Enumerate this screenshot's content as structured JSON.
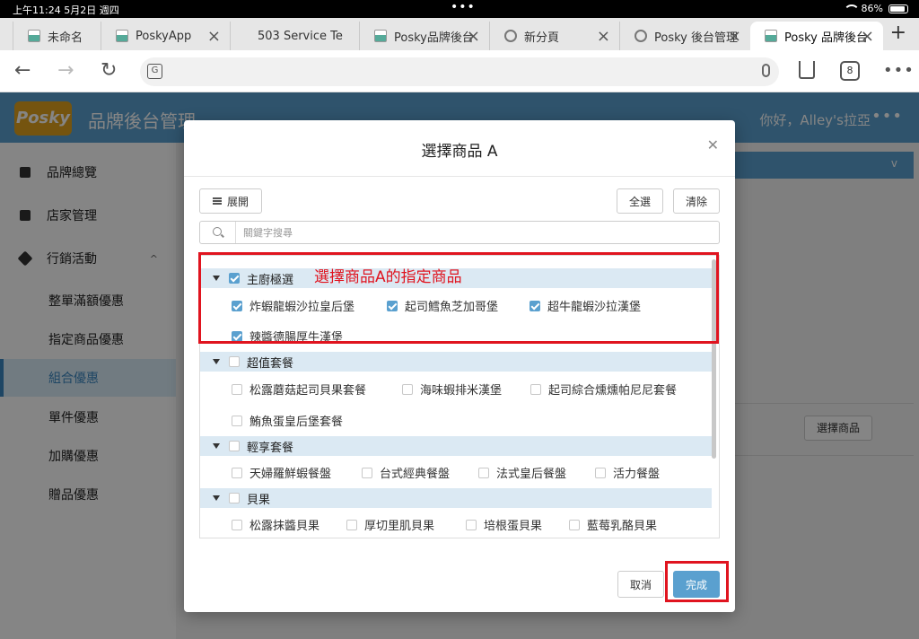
{
  "status": {
    "time": "上午11:24  5月2日 週四",
    "battery": "86%"
  },
  "tabs": [
    {
      "title": "未命名",
      "favicon": "mountain-favicon"
    },
    {
      "title": "PoskyApp",
      "favicon": "mountain-favicon"
    },
    {
      "title": "503 Service Te",
      "favicon": "none"
    },
    {
      "title": "Posky品牌後台",
      "favicon": "mountain-favicon"
    },
    {
      "title": "新分頁",
      "favicon": "globe-favicon"
    },
    {
      "title": "Posky 後台管理",
      "favicon": "globe-favicon"
    },
    {
      "title": "Posky 品牌後台",
      "favicon": "mountain-favicon",
      "active": true
    }
  ],
  "toolbar": {
    "tab_count": "8",
    "translate_glyph": "G"
  },
  "app": {
    "logo": "Posky",
    "title": "品牌後台管理",
    "greeting": "你好，Alley's拉亞",
    "select_goods_label": "選擇商品"
  },
  "sidebar": {
    "items": [
      {
        "label": "品牌總覽",
        "icon": "home-icon"
      },
      {
        "label": "店家管理",
        "icon": "store-icon"
      },
      {
        "label": "行銷活動",
        "icon": "send-icon",
        "expanded": true
      },
      {
        "label": "整單滿額優惠"
      },
      {
        "label": "指定商品優惠"
      },
      {
        "label": "組合優惠",
        "active": true
      },
      {
        "label": "單件優惠"
      },
      {
        "label": "加購優惠"
      },
      {
        "label": "贈品優惠"
      }
    ]
  },
  "modal": {
    "title": "選擇商品 A",
    "expand_label": "展開",
    "select_all_label": "全選",
    "clear_label": "清除",
    "search_placeholder": "關鍵字搜尋",
    "cancel_label": "取消",
    "done_label": "完成",
    "categories": [
      {
        "name": "主廚極選",
        "checked": true,
        "items": [
          {
            "label": "炸蝦龍蝦沙拉皇后堡",
            "checked": true
          },
          {
            "label": "起司鱈魚芝加哥堡",
            "checked": true
          },
          {
            "label": "超牛龍蝦沙拉漢堡",
            "checked": true
          },
          {
            "label": "辣醬德腸厚牛漢堡",
            "checked": true
          }
        ]
      },
      {
        "name": "超值套餐",
        "checked": false,
        "items": [
          {
            "label": "松露蘑菇起司貝果套餐",
            "checked": false
          },
          {
            "label": "海味蝦排米漢堡",
            "checked": false
          },
          {
            "label": "起司綜合燻燻帕尼尼套餐",
            "checked": false
          },
          {
            "label": "鮪魚蛋皇后堡套餐",
            "checked": false
          }
        ]
      },
      {
        "name": "輕享套餐",
        "checked": false,
        "items": [
          {
            "label": "天婦羅鮮蝦餐盤",
            "checked": false
          },
          {
            "label": "台式經典餐盤",
            "checked": false
          },
          {
            "label": "法式皇后餐盤",
            "checked": false
          },
          {
            "label": "活力餐盤",
            "checked": false
          }
        ]
      },
      {
        "name": "貝果",
        "checked": false,
        "items": [
          {
            "label": "松露抹醬貝果",
            "checked": false
          },
          {
            "label": "厚切里肌貝果",
            "checked": false
          },
          {
            "label": "培根蛋貝果",
            "checked": false
          },
          {
            "label": "藍莓乳酪貝果",
            "checked": false
          }
        ]
      }
    ]
  },
  "annotation": {
    "text": "選擇商品A的指定商品",
    "color": "#e0141f"
  },
  "colors": {
    "brand": "#5aa0cf",
    "highlight": "#e0141f"
  }
}
